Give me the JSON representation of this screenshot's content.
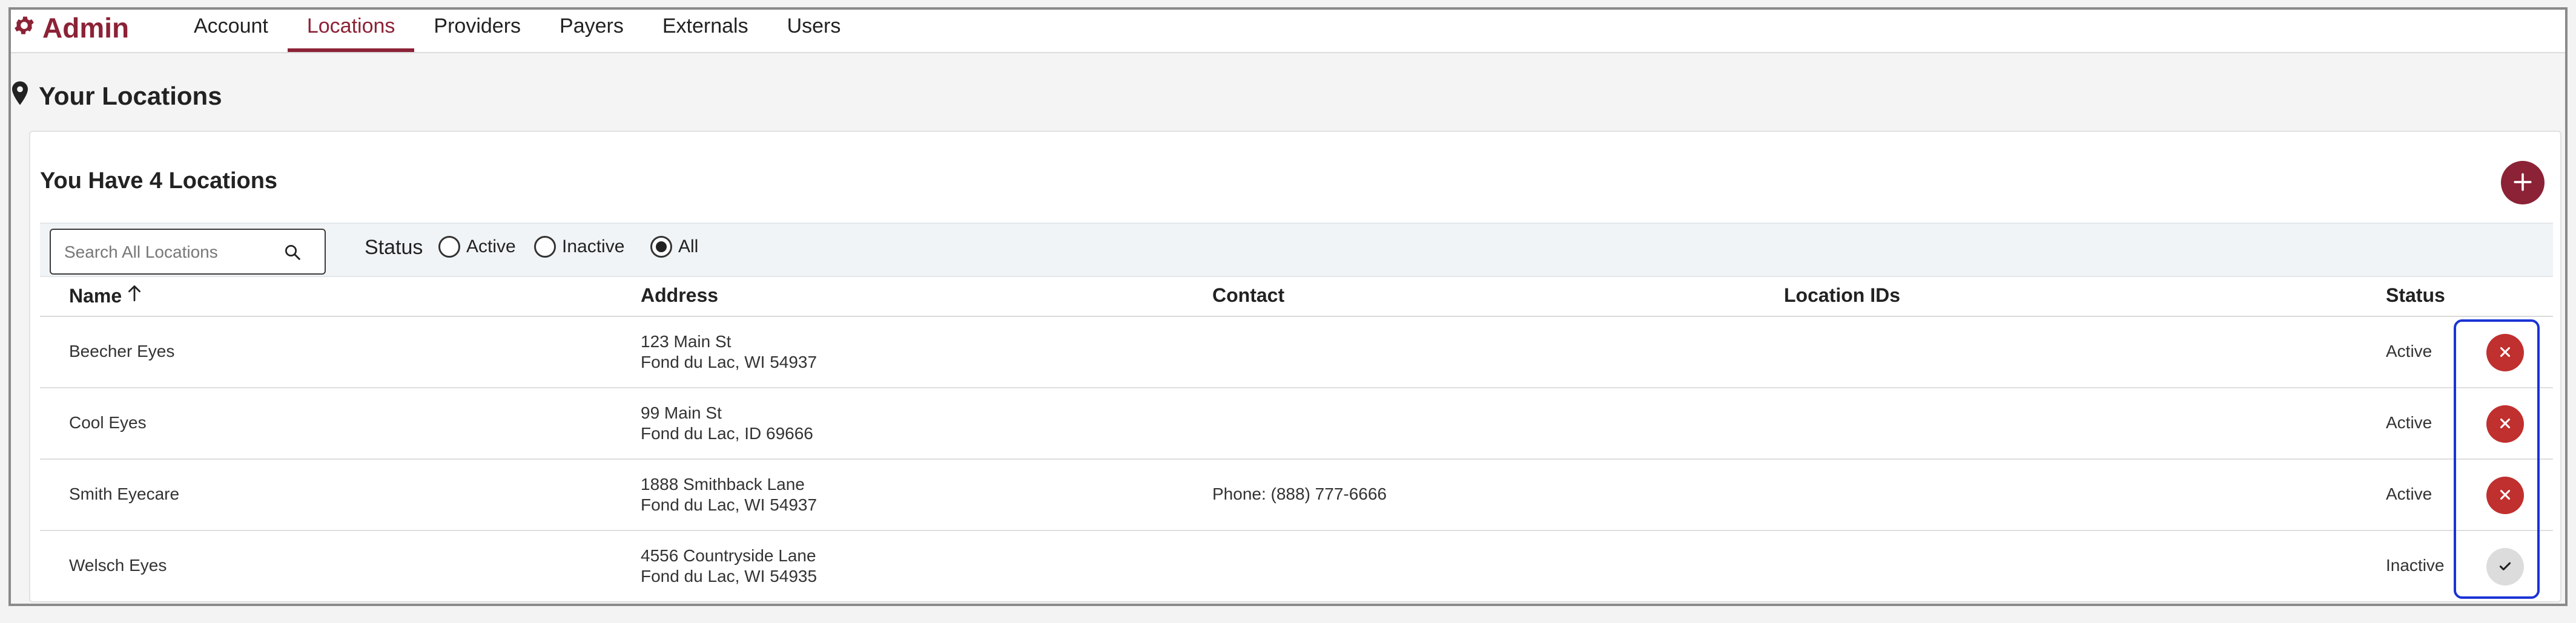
{
  "brand": {
    "title": "Admin"
  },
  "nav": {
    "tabs": [
      {
        "label": "Account",
        "active": false
      },
      {
        "label": "Locations",
        "active": true
      },
      {
        "label": "Providers",
        "active": false
      },
      {
        "label": "Payers",
        "active": false
      },
      {
        "label": "Externals",
        "active": false
      },
      {
        "label": "Users",
        "active": false
      }
    ]
  },
  "page": {
    "title": "Your Locations"
  },
  "card": {
    "title": "You Have 4 Locations",
    "add_icon": "plus-icon"
  },
  "filters": {
    "search_placeholder": "Search All Locations",
    "status_label": "Status",
    "options": [
      {
        "label": "Active",
        "checked": false
      },
      {
        "label": "Inactive",
        "checked": false
      },
      {
        "label": "All",
        "checked": true
      }
    ]
  },
  "table": {
    "columns": {
      "name": "Name",
      "address": "Address",
      "contact": "Contact",
      "location_ids": "Location IDs",
      "status": "Status"
    },
    "rows": [
      {
        "name": "Beecher Eyes",
        "address_line1": "123 Main St",
        "address_line2": "Fond du Lac, WI 54937",
        "contact": "",
        "location_ids": "",
        "status": "Active",
        "action": "deactivate"
      },
      {
        "name": "Cool Eyes",
        "address_line1": "99 Main St",
        "address_line2": "Fond du Lac, ID 69666",
        "contact": "",
        "location_ids": "",
        "status": "Active",
        "action": "deactivate"
      },
      {
        "name": "Smith Eyecare",
        "address_line1": "1888 Smithback Lane",
        "address_line2": "Fond du Lac, WI 54937",
        "contact": "Phone:  (888) 777-6666",
        "location_ids": "",
        "status": "Active",
        "action": "deactivate"
      },
      {
        "name": "Welsch Eyes",
        "address_line1": "4556 Countryside Lane",
        "address_line2": "Fond du Lac, WI 54935",
        "contact": "",
        "location_ids": "",
        "status": "Inactive",
        "action": "activate"
      }
    ]
  },
  "colors": {
    "brand": "#8b2236",
    "deactivate": "#c0302e",
    "activate": "#dcdcdc",
    "highlight": "#1a33d6"
  }
}
